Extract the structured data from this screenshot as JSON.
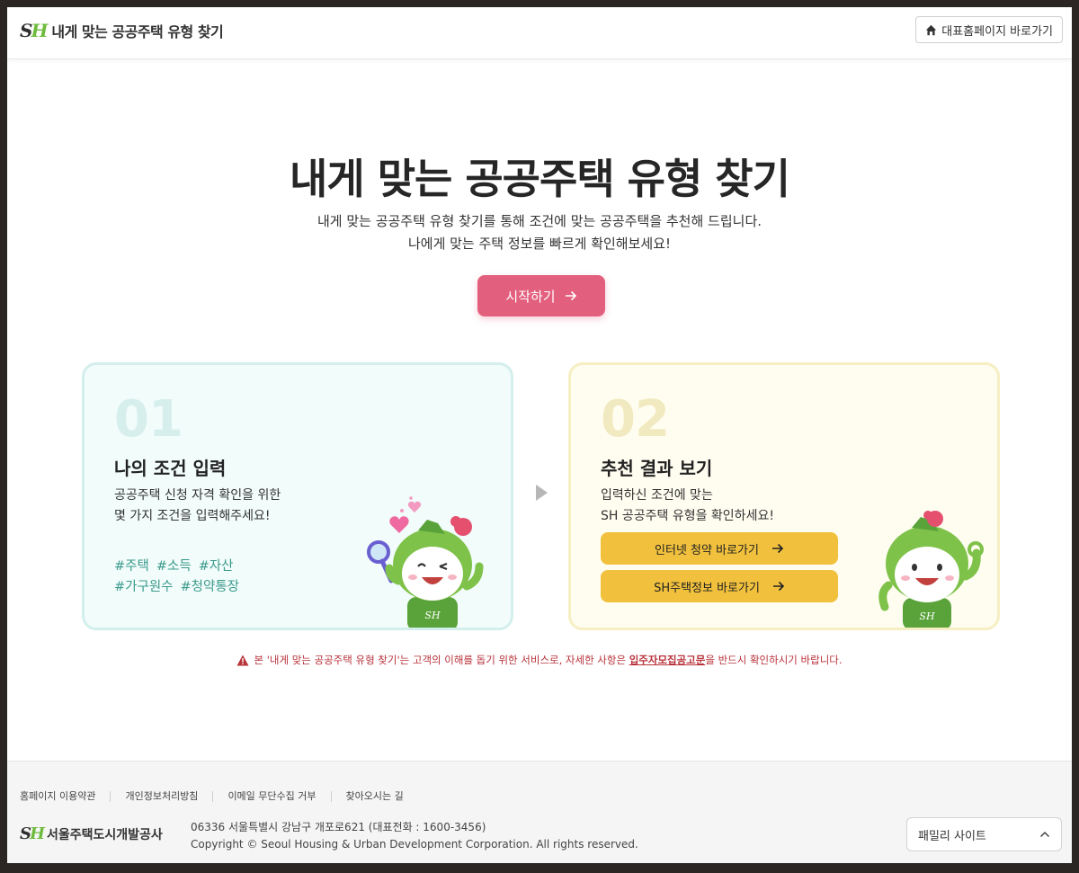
{
  "header": {
    "logo_mark_s": "S",
    "logo_mark_h": "H",
    "title": "내게 맞는 공공주택 유형 찾기",
    "home_button": "대표홈페이지 바로가기"
  },
  "hero": {
    "title": "내게 맞는 공공주택 유형 찾기",
    "sub_line1": "내게 맞는 공공주택 유형 찾기를 통해 조건에 맞는 공공주택을 추천해 드립니다.",
    "sub_line2": "나에게 맞는 주택 정보를 빠르게 확인해보세요!",
    "start_button": "시작하기"
  },
  "cards": [
    {
      "number": "01",
      "title": "나의 조건 입력",
      "desc_line1": "공공주택 신청 자격 확인을 위한",
      "desc_line2": "몇 가지 조건을 입력해주세요!",
      "tags_row1": [
        "#주택",
        "#소득",
        "#자산"
      ],
      "tags_row2": [
        "#가구원수",
        "#청약통장"
      ]
    },
    {
      "number": "02",
      "title": "추천 결과 보기",
      "desc_line1": "입력하신 조건에 맞는",
      "desc_line2": "SH 공공주택 유형을 확인하세요!",
      "buttons": [
        "인터넷 청약 바로가기",
        "SH주택정보 바로가기"
      ]
    }
  ],
  "notice": {
    "before": "본 '내게 맞는 공공주택 유형 찾기'는 고객의 이해를 돕기 위한 서비스로, 자세한 사항은",
    "link": "입주자모집공고문",
    "after": "을 반드시 확인하시기 바랍니다."
  },
  "footer": {
    "links": [
      "홈페이지 이용약관",
      "개인정보처리방침",
      "이메일 무단수집 거부",
      "찾아오시는 길"
    ],
    "org_name": "서울주택도시개발공사",
    "address": "06336 서울특별시 강남구 개포로621 (대표전화 : 1600-3456)",
    "copyright": "Copyright © Seoul Housing & Urban Development Corporation. All rights reserved.",
    "family_site": "패밀리 사이트"
  },
  "colors": {
    "accent_pink": "#e2607e",
    "button_yellow": "#f1c13d",
    "tag_teal": "#3c9a8b",
    "notice_red": "#b8323a",
    "logo_green": "#6dbb3c"
  },
  "icons": [
    "home-icon",
    "arrow-right-icon",
    "warning-icon",
    "chevron-up-icon",
    "triangle-right-icon"
  ]
}
